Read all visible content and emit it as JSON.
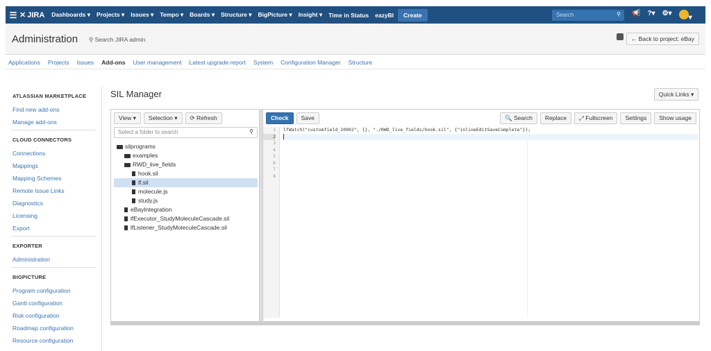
{
  "topbar": {
    "logo": "JIRA",
    "nav": [
      "Dashboards ▾",
      "Projects ▾",
      "Issues ▾",
      "Tempo ▾",
      "Boards ▾",
      "Structure ▾",
      "BigPicture ▾",
      "Insight ▾",
      "Time in Status",
      "eazyBI"
    ],
    "create": "Create",
    "search_placeholder": "Search",
    "icons": [
      "notification-icon",
      "help-icon",
      "settings-icon",
      "avatar"
    ],
    "help": "?▾",
    "settings": "⚙▾",
    "avatar_caret": "▾"
  },
  "admin": {
    "title": "Administration",
    "search": "Search JIRA admin",
    "back": "← Back to project: eBay"
  },
  "tabs": [
    "Applications",
    "Projects",
    "Issues",
    "Add-ons",
    "User management",
    "Latest upgrade report",
    "System",
    "Configuration Manager",
    "Structure"
  ],
  "active_tab": "Add-ons",
  "sidebar": {
    "marketplace": {
      "title": "ATLASSIAN MARKETPLACE",
      "items": [
        "Find new add-ons",
        "Manage add-ons"
      ]
    },
    "cloud": {
      "title": "CLOUD CONNECTORS",
      "items": [
        "Connections",
        "Mappings",
        "Mapping Schemes",
        "Remote Issue Links",
        "Diagnostics",
        "Licensing",
        "Export"
      ]
    },
    "exporter": {
      "title": "EXPORTER",
      "items": [
        "Administration"
      ]
    },
    "bigpicture": {
      "title": "BIGPICTURE",
      "items": [
        "Program configuration",
        "Gantt configuration",
        "Risk configuration",
        "Roadmap configuration",
        "Resource configuration"
      ]
    }
  },
  "page": {
    "title": "SIL Manager",
    "quick_links": "Quick Links ▾"
  },
  "left_panel": {
    "view": "View ▾",
    "selection": "Selection ▾",
    "refresh": "⟳ Refresh",
    "folder_search_placeholder": "Select a folder to search",
    "tree": [
      {
        "label": "silprograms",
        "type": "folder-open",
        "indent": 0
      },
      {
        "label": "examples",
        "type": "folder",
        "indent": 1
      },
      {
        "label": "RWD_live_fields",
        "type": "folder-open",
        "indent": 1
      },
      {
        "label": "hook.sil",
        "type": "file",
        "indent": 2
      },
      {
        "label": "lf.sil",
        "type": "file",
        "indent": 2,
        "selected": true
      },
      {
        "label": "molecule.js",
        "type": "file",
        "indent": 2
      },
      {
        "label": "study.js",
        "type": "file",
        "indent": 2
      },
      {
        "label": "eBayIntegration",
        "type": "file",
        "indent": 1
      },
      {
        "label": "lfExecutor_StudyMoleculeCascade.sil",
        "type": "file",
        "indent": 1
      },
      {
        "label": "lfListener_StudyMoleculeCascade.sil",
        "type": "file",
        "indent": 1
      }
    ]
  },
  "editor": {
    "check": "Check",
    "save": "Save",
    "search": "🔍 Search",
    "replace": "Replace",
    "fullscreen": "⤢ Fullscreen",
    "settings": "Settings",
    "show_usage": "Show usage",
    "line_numbers": [
      "1",
      "2",
      "3",
      "4",
      "5",
      "6",
      "7",
      "8"
    ],
    "current_line": 2,
    "lines": [
      "lfWatch(\"customfield_10902\", {}, \"./RWD_live_fields/hook.sil\", {\"inlineEditSaveComplete\"});",
      "",
      "",
      "",
      "",
      "",
      "",
      ""
    ]
  }
}
